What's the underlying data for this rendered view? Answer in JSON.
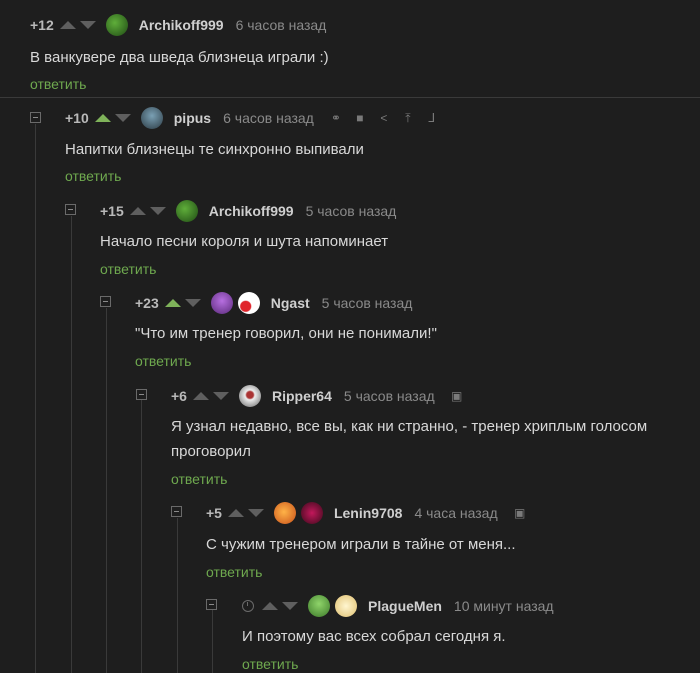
{
  "comments": [
    {
      "rating": "+12",
      "user": "Archikoff999",
      "time": "6 часов назад",
      "text": "В ванкувере два шведа близнеца играли :)",
      "reply": "ответить"
    },
    {
      "rating": "+10",
      "user": "pipus",
      "time": "6 часов назад",
      "text": "Напитки близнецы те синхронно выпивали",
      "reply": "ответить"
    },
    {
      "rating": "+15",
      "user": "Archikoff999",
      "time": "5 часов назад",
      "text": "Начало песни короля и шута напоминает",
      "reply": "ответить"
    },
    {
      "rating": "+23",
      "user": "Ngast",
      "time": "5 часов назад",
      "text": "\"Что им тренер говорил, они не понимали!\"",
      "reply": "ответить"
    },
    {
      "rating": "+6",
      "user": "Ripper64",
      "time": "5 часов назад",
      "text_line1": "Я узнал недавно, все вы, как ни странно, - тренер хриплым голосом",
      "text_line2": "проговорил",
      "reply": "ответить"
    },
    {
      "rating": "+5",
      "user": "Lenin9708",
      "time": "4 часа назад",
      "text": "С чужим тренером играли в тайне от меня...",
      "reply": "ответить"
    },
    {
      "rating": "",
      "user": "PlagueMen",
      "time": "10 минут назад",
      "text": "И поэтому вас всех собрал сегодня я.",
      "reply": "ответить"
    }
  ],
  "colors": {
    "background": "#1e1e1e",
    "reply": "#6fa94f",
    "upvote_active": "#7fb35a"
  },
  "icons": [
    "link-icon",
    "save-icon",
    "share-icon",
    "scroll-to-parent-icon",
    "branch-icon",
    "android-icon",
    "clock-icon"
  ]
}
